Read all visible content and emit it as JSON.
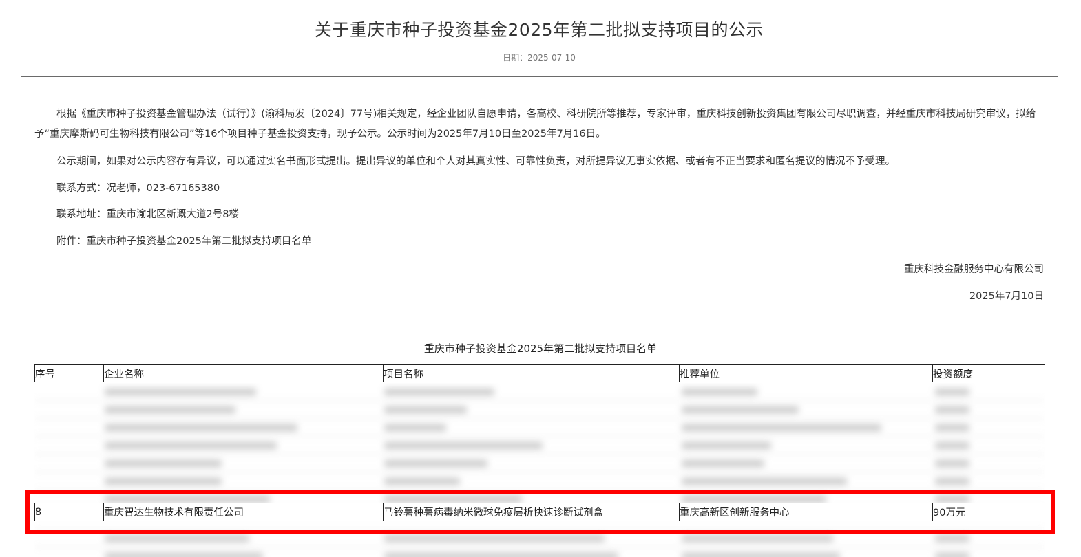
{
  "header": {
    "title": "关于重庆市种子投资基金2025年第二批拟支持项目的公示",
    "date": "日期：2025-07-10"
  },
  "body": {
    "paragraph1": "根据《重庆市种子投资基金管理办法（试行）》(渝科局发〔2024〕77号)相关规定，经企业团队自愿申请，各高校、科研院所等推荐，专家评审，重庆科技创新投资集团有限公司尽职调查，并经重庆市科技局研究审议，拟给予“重庆摩斯码可生物科技有限公司”等16个项目种子基金投资支持，现予公示。公示时间为2025年7月10日至2025年7月16日。",
    "paragraph2": "公示期间，如果对公示内容存有异议，可以通过实名书面形式提出。提出异议的单位和个人对其真实性、可靠性负责，对所提异议无事实依据、或者有不正当要求和匿名提议的情况不予受理。",
    "contact": "联系方式：况老师，023-67165380",
    "address": "联系地址：重庆市渝北区新溉大道2号8楼",
    "attachment": "附件：重庆市种子投资基金2025年第二批拟支持项目名单",
    "signature_org": "重庆科技金融服务中心有限公司",
    "signature_date": "2025年7月10日"
  },
  "table": {
    "title": "重庆市种子投资基金2025年第二批拟支持项目名单",
    "headers": [
      "序号",
      "企业名称",
      "项目名称",
      "推荐单位",
      "投资额度"
    ],
    "highlighted_row": {
      "index": "8",
      "company": "重庆智达生物技术有限责任公司",
      "project": "马铃薯种薯病毒纳米微球免疫层析快速诊断试剂盒",
      "recommender": "重庆高新区创新服务中心",
      "amount": "90万元"
    }
  },
  "colors": {
    "highlight_border": "#ff0000",
    "rule": "#6a6a6a"
  }
}
